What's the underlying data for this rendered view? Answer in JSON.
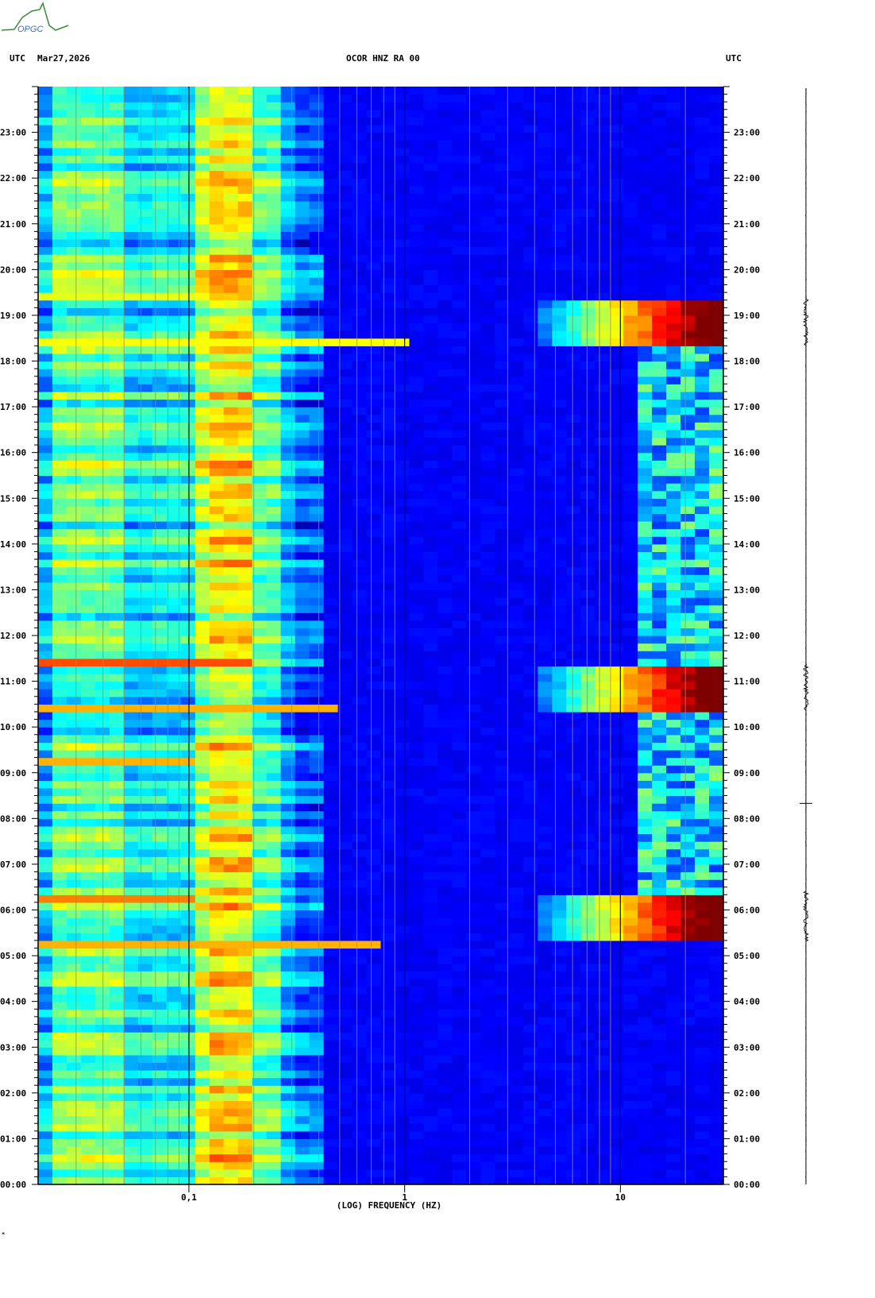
{
  "header": {
    "logo_text": "OPGC",
    "left_tz": "UTC",
    "date": "Mar27,2026",
    "station": "OCOR HNZ RA 00",
    "right_tz": "UTC"
  },
  "footer_mark": "*",
  "chart_data": {
    "type": "heatmap",
    "title": "OCOR HNZ RA 00",
    "xlabel": "(LOG) FREQUENCY (HZ)",
    "ylabel": "UTC",
    "xscale": "log",
    "xlim": [
      0.02,
      30
    ],
    "ylim_hours": [
      0,
      24
    ],
    "x_tick_labels": [
      {
        "value": 0.1,
        "label": "0,1"
      },
      {
        "value": 1,
        "label": "1"
      },
      {
        "value": 10,
        "label": "10"
      }
    ],
    "y_tick_labels": [
      "00:00",
      "01:00",
      "02:00",
      "03:00",
      "04:00",
      "05:00",
      "06:00",
      "07:00",
      "08:00",
      "09:00",
      "10:00",
      "11:00",
      "12:00",
      "13:00",
      "14:00",
      "15:00",
      "16:00",
      "17:00",
      "18:00",
      "19:00",
      "20:00",
      "21:00",
      "22:00",
      "23:00"
    ],
    "colormap": [
      "#00007f",
      "#0000ff",
      "#007fff",
      "#00ffff",
      "#7fff7f",
      "#ffff00",
      "#ff7f00",
      "#ff0000",
      "#7f0000"
    ],
    "baseline_levels": [
      {
        "f": [
          0.02,
          0.025
        ],
        "level": 0.3
      },
      {
        "f": [
          0.025,
          0.05
        ],
        "level": 0.47
      },
      {
        "f": [
          0.05,
          0.07
        ],
        "level": 0.36
      },
      {
        "f": [
          0.07,
          0.1
        ],
        "level": 0.38
      },
      {
        "f": [
          0.1,
          0.13
        ],
        "level": 0.55
      },
      {
        "f": [
          0.13,
          0.2
        ],
        "level": 0.63
      },
      {
        "f": [
          0.2,
          0.25
        ],
        "level": 0.45
      },
      {
        "f": [
          0.25,
          0.3
        ],
        "level": 0.3
      },
      {
        "f": [
          0.3,
          0.4
        ],
        "level": 0.22
      },
      {
        "f": [
          0.4,
          30
        ],
        "level": 0.12
      }
    ],
    "high_freq_bursts": [
      {
        "start": 5.33,
        "end": 6.4,
        "fmin": 4,
        "peak": 1.0
      },
      {
        "start": 10.35,
        "end": 11.4,
        "fmin": 4,
        "peak": 1.0
      },
      {
        "start": 18.35,
        "end": 19.35,
        "fmin": 4,
        "peak": 1.0
      }
    ],
    "daytime_activity": {
      "start": 6.4,
      "end": 18.35,
      "fmin": 12,
      "level": 0.35
    },
    "transients": [
      {
        "time": 5.33,
        "fmax": 0.8,
        "level": 0.7
      },
      {
        "time": 6.3,
        "fmax": 0.1,
        "level": 0.75
      },
      {
        "time": 9.3,
        "fmax": 0.1,
        "level": 0.7
      },
      {
        "time": 10.4,
        "fmax": 0.5,
        "level": 0.7
      },
      {
        "time": 11.4,
        "fmax": 0.2,
        "level": 0.8
      },
      {
        "time": 18.35,
        "fmax": 1.0,
        "level": 0.62
      },
      {
        "time": 19.35,
        "fmax": 0.1,
        "level": 0.6
      }
    ]
  }
}
